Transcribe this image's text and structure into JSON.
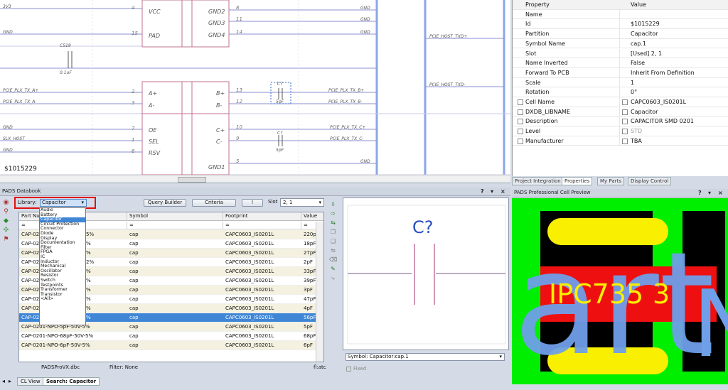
{
  "schematic": {
    "id_label": "$1015229",
    "nets_left": [
      "3V3",
      "GND",
      "PCIE_PLX_TX_A+",
      "PCIE_PLX_TX_A-",
      "GND",
      "SLX_HOST",
      "GND"
    ],
    "pin_numbers_left": [
      "4",
      "15",
      "2",
      "3",
      "7",
      "1",
      "6"
    ],
    "pin_names_left": [
      "VCC",
      "PAD",
      "A+",
      "A-",
      "OE",
      "SEL",
      "RSV"
    ],
    "pin_names_right": [
      "GND2",
      "GND3",
      "GND4",
      "B+",
      "B-",
      "C+",
      "C-",
      "GND1"
    ],
    "pin_numbers_right": [
      "8",
      "11",
      "14",
      "13",
      "12",
      "10",
      "9",
      "5"
    ],
    "nets_right": [
      "GND",
      "GND",
      "GND",
      "PCIE_PLX_TX_B+",
      "PCIE_PLX_TX_B-",
      "PCIE_PLX_TX_C+",
      "PCIE_PLX_TX_C-",
      "GND"
    ],
    "far_nets": [
      "PCIE_HOST_TXD+",
      "PCIE_HOST_TXD-"
    ],
    "cap_refs": [
      "C519",
      "C?",
      "C?"
    ],
    "cap_values": [
      "0.1uF",
      "5pF",
      "5pF"
    ]
  },
  "properties": {
    "header": {
      "key": "Property",
      "value": "Value"
    },
    "rows": [
      {
        "key": "Name",
        "value": "",
        "checkbox": false
      },
      {
        "key": "Id",
        "value": "$1015229",
        "checkbox": false
      },
      {
        "key": "Partition",
        "value": "Capacitor",
        "checkbox": false
      },
      {
        "key": "Symbol Name",
        "value": "cap.1",
        "checkbox": false
      },
      {
        "key": "Slot",
        "value": "[Used] 2, 1",
        "checkbox": false
      },
      {
        "key": "Name Inverted",
        "value": "False",
        "checkbox": false
      },
      {
        "key": "Forward To PCB",
        "value": "Inherit From Definition",
        "checkbox": false
      },
      {
        "key": "Scale",
        "value": "1",
        "checkbox": false
      },
      {
        "key": "Rotation",
        "value": "0°",
        "checkbox": false
      },
      {
        "key": "Cell Name",
        "value": "CAPC0603_IS0201L",
        "checkbox": true
      },
      {
        "key": "DXDB_LIBNAME",
        "value": "Capacitor",
        "checkbox": true
      },
      {
        "key": "Description",
        "value": "CAPACITOR SMD 0201",
        "checkbox": true
      },
      {
        "key": "Level",
        "value": "STD",
        "checkbox": true
      },
      {
        "key": "Manufacturer",
        "value": "TBA",
        "checkbox": true
      }
    ],
    "tabs": [
      "Project Integration",
      "Properties",
      "My Parts",
      "Display Control"
    ]
  },
  "databook": {
    "title": "PADS Databook",
    "library_label": "Library:",
    "library_value": "Capacitor",
    "query_builder": "Query Builder",
    "criteria": "Criteria",
    "one": "!",
    "slot_label": "Slot",
    "slot_value": "2, 1",
    "columns": [
      "Part Nu",
      "Symbol",
      "Footprint",
      "Value"
    ],
    "filter_row": [
      "=",
      "=",
      "=",
      "="
    ],
    "rows": [
      {
        "part": "CAP-02",
        "tol": "5%",
        "symbol": "cap",
        "footprint": "CAPC0603_IS0201L",
        "value": "220pF"
      },
      {
        "part": "CAP-02",
        "tol": "%",
        "symbol": "cap",
        "footprint": "CAPC0603_IS0201L",
        "value": "18pF"
      },
      {
        "part": "CAP-02",
        "tol": "%",
        "symbol": "cap",
        "footprint": "CAPC0603_IS0201L",
        "value": "27pF"
      },
      {
        "part": "CAP-02",
        "tol": "2%",
        "symbol": "cap",
        "footprint": "CAPC0603_IS0201L",
        "value": "2pF"
      },
      {
        "part": "CAP-02",
        "tol": "%",
        "symbol": "cap",
        "footprint": "CAPC0603_IS0201L",
        "value": "33pF"
      },
      {
        "part": "CAP-02",
        "tol": "%",
        "symbol": "cap",
        "footprint": "CAPC0603_IS0201L",
        "value": "39pF"
      },
      {
        "part": "CAP-02",
        "tol": "%",
        "symbol": "cap",
        "footprint": "CAPC0603_IS0201L",
        "value": "3pF"
      },
      {
        "part": "CAP-02",
        "tol": "%",
        "symbol": "cap",
        "footprint": "CAPC0603_IS0201L",
        "value": "47pF"
      },
      {
        "part": "CAP-02",
        "tol": "%",
        "symbol": "cap",
        "footprint": "CAPC0603_IS0201L",
        "value": "4pF"
      },
      {
        "part": "CAP-02",
        "tol": "%",
        "symbol": "cap",
        "footprint": "CAPC0603_IS0201L",
        "value": "56pF"
      },
      {
        "part": "CAP-0201-NPO-5pF-50V-5%",
        "tol": "",
        "symbol": "cap",
        "footprint": "CAPC0603_IS0201L",
        "value": "5pF"
      },
      {
        "part": "CAP-0201-NPO-68pF-50V-5%",
        "tol": "",
        "symbol": "cap",
        "footprint": "CAPC0603_IS0201L",
        "value": "68pF"
      },
      {
        "part": "CAP-0201-NPO-6pF-50V-5%",
        "tol": "",
        "symbol": "cap",
        "footprint": "CAPC0603_IS0201L",
        "value": "6pF"
      }
    ],
    "selected_row": 9,
    "dropdown": [
      "Audio",
      "Battery",
      "Capacitor",
      "Circuit Protection",
      "Connector",
      "Diode",
      "Display",
      "Documentation",
      "Filter",
      "FPGA",
      "IC",
      "Inductor",
      "Mechanical",
      "Oscillator",
      "Resistor",
      "Switch",
      "Testpoints",
      "Transformer",
      "Transistor",
      "<All>"
    ],
    "dropdown_selected": 2,
    "symbol_ref": "C?",
    "symbol_combo": "Symbol: Capacitor:cap.1",
    "fixed_label": "Fixed",
    "status_file": "PADSProVX.dbc",
    "status_filter": "Filter: None",
    "status_right": "fl:atc",
    "bottom_tabs": [
      "CL View",
      "Search: Capacitor"
    ]
  },
  "cell_preview": {
    "title": "PADS Professional Cell Preview",
    "text": "IPC735",
    "text2": "3",
    "colors": {
      "green": "#00ee00",
      "yellow": "#f8f000",
      "red": "#ee1010",
      "blue": "#6f9fe8"
    }
  }
}
